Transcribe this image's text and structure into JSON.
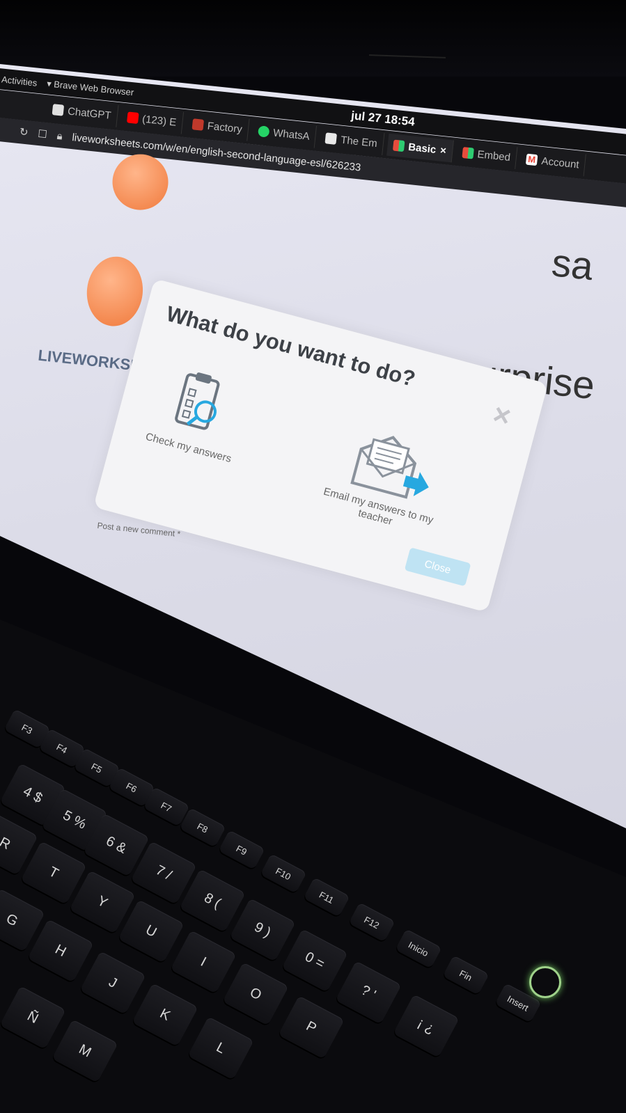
{
  "os_bar": {
    "activities": "Activities",
    "app_name": "Brave Web Browser",
    "clock_date": "jul 27",
    "clock_time": "18:54"
  },
  "browser": {
    "tabs": [
      {
        "label": "ChatGPT",
        "active": false,
        "favicon_color": "#e0e0e0"
      },
      {
        "label": "(123) E",
        "active": false,
        "favicon_color": "#ff0000"
      },
      {
        "label": "Factory",
        "active": false,
        "favicon_color": "#c0392b"
      },
      {
        "label": "WhatsA",
        "active": false,
        "favicon_color": "#25d366"
      },
      {
        "label": "The Em",
        "active": false,
        "favicon_color": "#e8e8e8"
      },
      {
        "label": "Basic",
        "active": true,
        "favicon_color": "#e74c3c"
      },
      {
        "label": "Embed",
        "active": false,
        "favicon_color": "#e74c3c"
      },
      {
        "label": "Account",
        "active": false,
        "favicon_color": "#ea4335"
      }
    ],
    "active_tab_close": "×",
    "url": "liveworksheets.com/w/en/english-second-language-esl/626233"
  },
  "page": {
    "logo_text": "LIVEWORKSH",
    "side_word_1": "sa",
    "side_word_2": "surprise",
    "comment_label": "Post a new comment *"
  },
  "modal": {
    "title": "What do you want to do?",
    "close_symbol": "×",
    "option_check": "Check my answers",
    "option_email": "Email my answers to my teacher",
    "close_button": "Close"
  },
  "keyboard": {
    "fn_keys": [
      "F3",
      "F4",
      "F5",
      "F6",
      "F7",
      "F8",
      "F9",
      "F10",
      "F11",
      "F12",
      "Inicio",
      "Fin",
      "Insert"
    ],
    "row_keys": [
      "4 $",
      "5 %",
      "6 &",
      "7 /",
      "8 (",
      "9 )",
      "0 =",
      "? '",
      "¡ ¿"
    ],
    "letters": [
      "R",
      "T",
      "Y",
      "U",
      "I",
      "O",
      "P",
      "G",
      "H",
      "J",
      "K",
      "L",
      "Ñ",
      "M"
    ]
  },
  "colors": {
    "modal_bg": "#f4f4f6",
    "accent_blue": "#27a8e0",
    "close_button_bg": "#bfe3f3",
    "power_led": "#9fd28a"
  }
}
